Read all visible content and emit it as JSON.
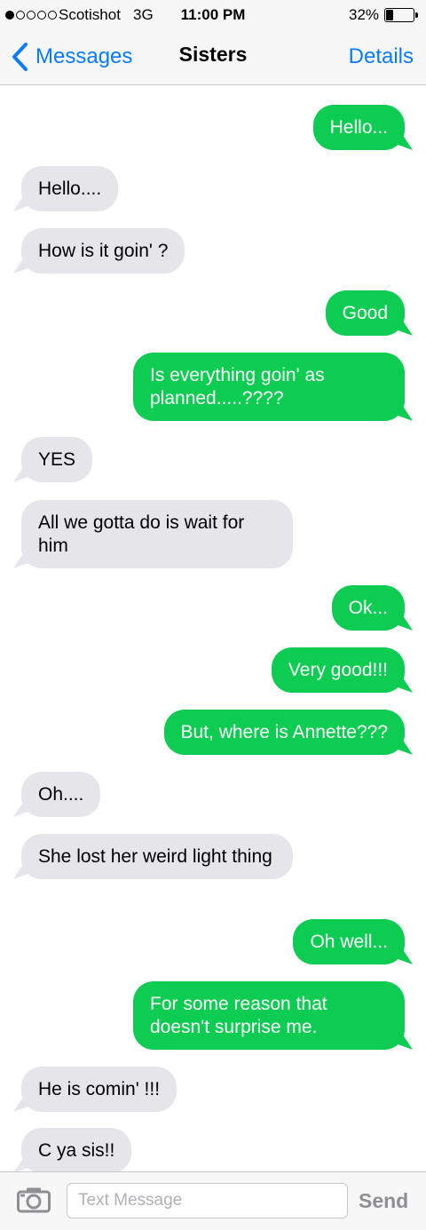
{
  "status_bar": {
    "signal_bars_filled": 1,
    "signal_bars_total": 5,
    "carrier": "Scotishot",
    "network": "3G",
    "time": "11:00 PM",
    "battery_percent": "32%",
    "battery_level": 0.32
  },
  "nav": {
    "back_label": "Messages",
    "title": "Sisters",
    "details_label": "Details"
  },
  "messages": [
    {
      "from": "me",
      "text": "Hello..."
    },
    {
      "from": "them",
      "text": "Hello...."
    },
    {
      "from": "them",
      "text": "How is it goin' ?"
    },
    {
      "from": "me",
      "text": "Good"
    },
    {
      "from": "me",
      "text": "Is everything goin' as planned.....????"
    },
    {
      "from": "them",
      "text": "YES"
    },
    {
      "from": "them",
      "text": "All we gotta do is wait for him"
    },
    {
      "from": "me",
      "text": "Ok..."
    },
    {
      "from": "me",
      "text": "Very good!!!"
    },
    {
      "from": "me",
      "text": "But, where is Annette???"
    },
    {
      "from": "them",
      "text": "Oh...."
    },
    {
      "from": "them",
      "text": "She lost her weird light thing"
    },
    {
      "from": "me",
      "text": "Oh well..."
    },
    {
      "from": "me",
      "text": "For some reason that doesn't surprise me."
    },
    {
      "from": "them",
      "text": "He is comin' !!!"
    },
    {
      "from": "them",
      "text": "C ya sis!!"
    }
  ],
  "input": {
    "placeholder": "Text Message",
    "value": "",
    "send_label": "Send"
  },
  "colors": {
    "sent_bubble": "#0ccc51",
    "received_bubble": "#e5e5ea",
    "accent": "#0a7aff"
  }
}
